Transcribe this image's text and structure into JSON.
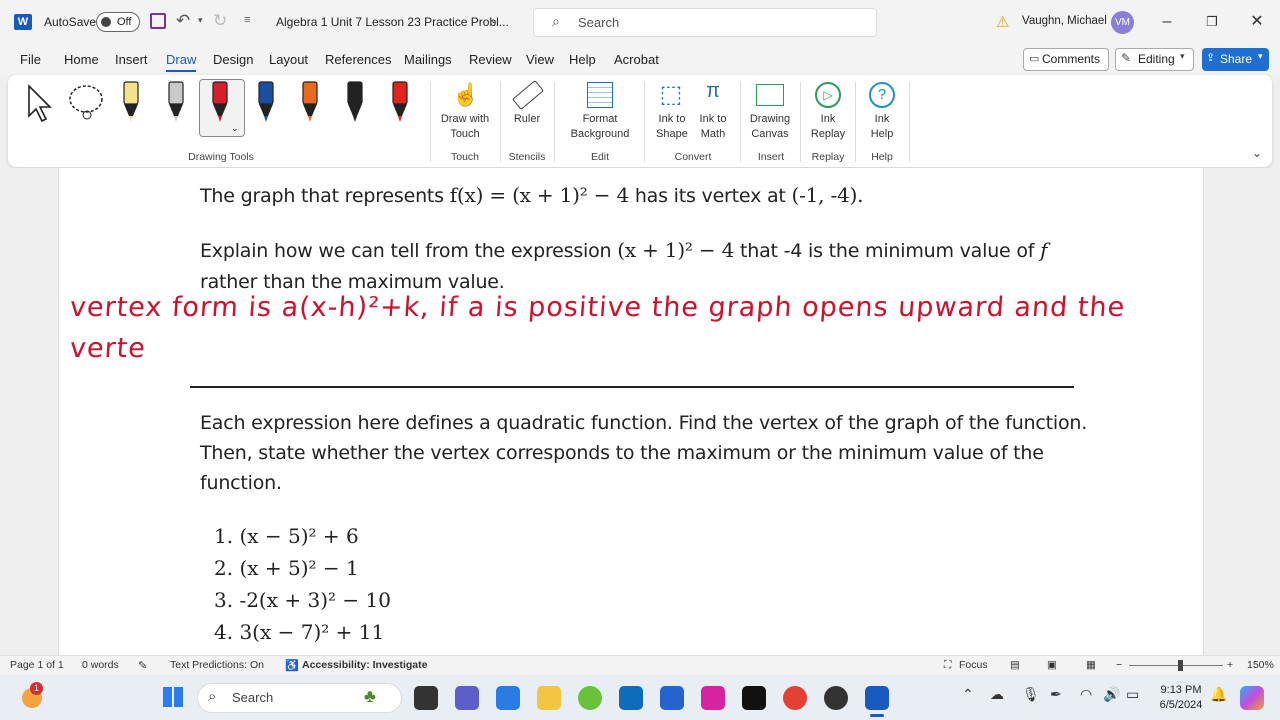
{
  "titlebar": {
    "autosave_label": "AutoSave",
    "autosave_state": "Off",
    "doc_title": "Algebra 1 Unit 7 Lesson 23 Practice Probl...",
    "search_placeholder": "Search",
    "user_name": "Vaughn, Michael",
    "user_initials": "VM"
  },
  "menu": {
    "items": [
      "File",
      "Home",
      "Insert",
      "Draw",
      "Design",
      "Layout",
      "References",
      "Mailings",
      "Review",
      "View",
      "Help",
      "Acrobat"
    ],
    "active": "Draw",
    "comments": "Comments",
    "editing": "Editing",
    "share": "Share"
  },
  "ribbon": {
    "draw_with_touch_1": "Draw with",
    "draw_with_touch_2": "Touch",
    "ruler": "Ruler",
    "format_bg_1": "Format",
    "format_bg_2": "Background",
    "ink_shape_1": "Ink to",
    "ink_shape_2": "Shape",
    "ink_math_1": "Ink to",
    "ink_math_2": "Math",
    "drawing_canvas_1": "Drawing",
    "drawing_canvas_2": "Canvas",
    "ink_replay_1": "Ink",
    "ink_replay_2": "Replay",
    "ink_help_1": "Ink",
    "ink_help_2": "Help",
    "groups": {
      "drawing_tools": "Drawing Tools",
      "touch": "Touch",
      "stencils": "Stencils",
      "edit": "Edit",
      "convert": "Convert",
      "insert": "Insert",
      "replay": "Replay",
      "help": "Help"
    },
    "pen_colors": [
      "#f2e38a",
      "#c9c9c9",
      "#d51f2b",
      "#1a4fa0",
      "#e86a1e",
      "#222222",
      "#e0231f"
    ]
  },
  "document": {
    "line1_pre": "The graph that represents",
    "line1_math": "f(x) = (x + 1)² − 4",
    "line1_post": "has its vertex at",
    "line1_vertex": "(-1, -4).",
    "line2_pre": "Explain how we can tell from the expression",
    "line2_math": "(x + 1)² − 4",
    "line2_post": "that -4 is the minimum value of",
    "line2_f": "f",
    "line3": "rather than the maximum value.",
    "ink_line1": "vertex form is a(x-h)²+k, if a is positive the graph opens upward and the",
    "ink_line2": "verte",
    "para1": "Each expression here defines a quadratic function. Find the vertex of the graph of the function.",
    "para2": "Then, state whether the vertex corresponds to the maximum or the minimum value of the",
    "para3": "function.",
    "items": [
      "1. (x − 5)² + 6",
      "2. (x + 5)² − 1",
      "3. -2(x + 3)² − 10",
      "4. 3(x − 7)² + 11"
    ]
  },
  "status": {
    "page": "Page 1 of 1",
    "words": "0 words",
    "text_predictions": "Text Predictions: On",
    "accessibility": "Accessibility: Investigate",
    "focus": "Focus",
    "zoom": "150%"
  },
  "taskbar": {
    "search": "Search",
    "time": "9:13 PM",
    "date": "6/5/2024",
    "badge": "1"
  }
}
